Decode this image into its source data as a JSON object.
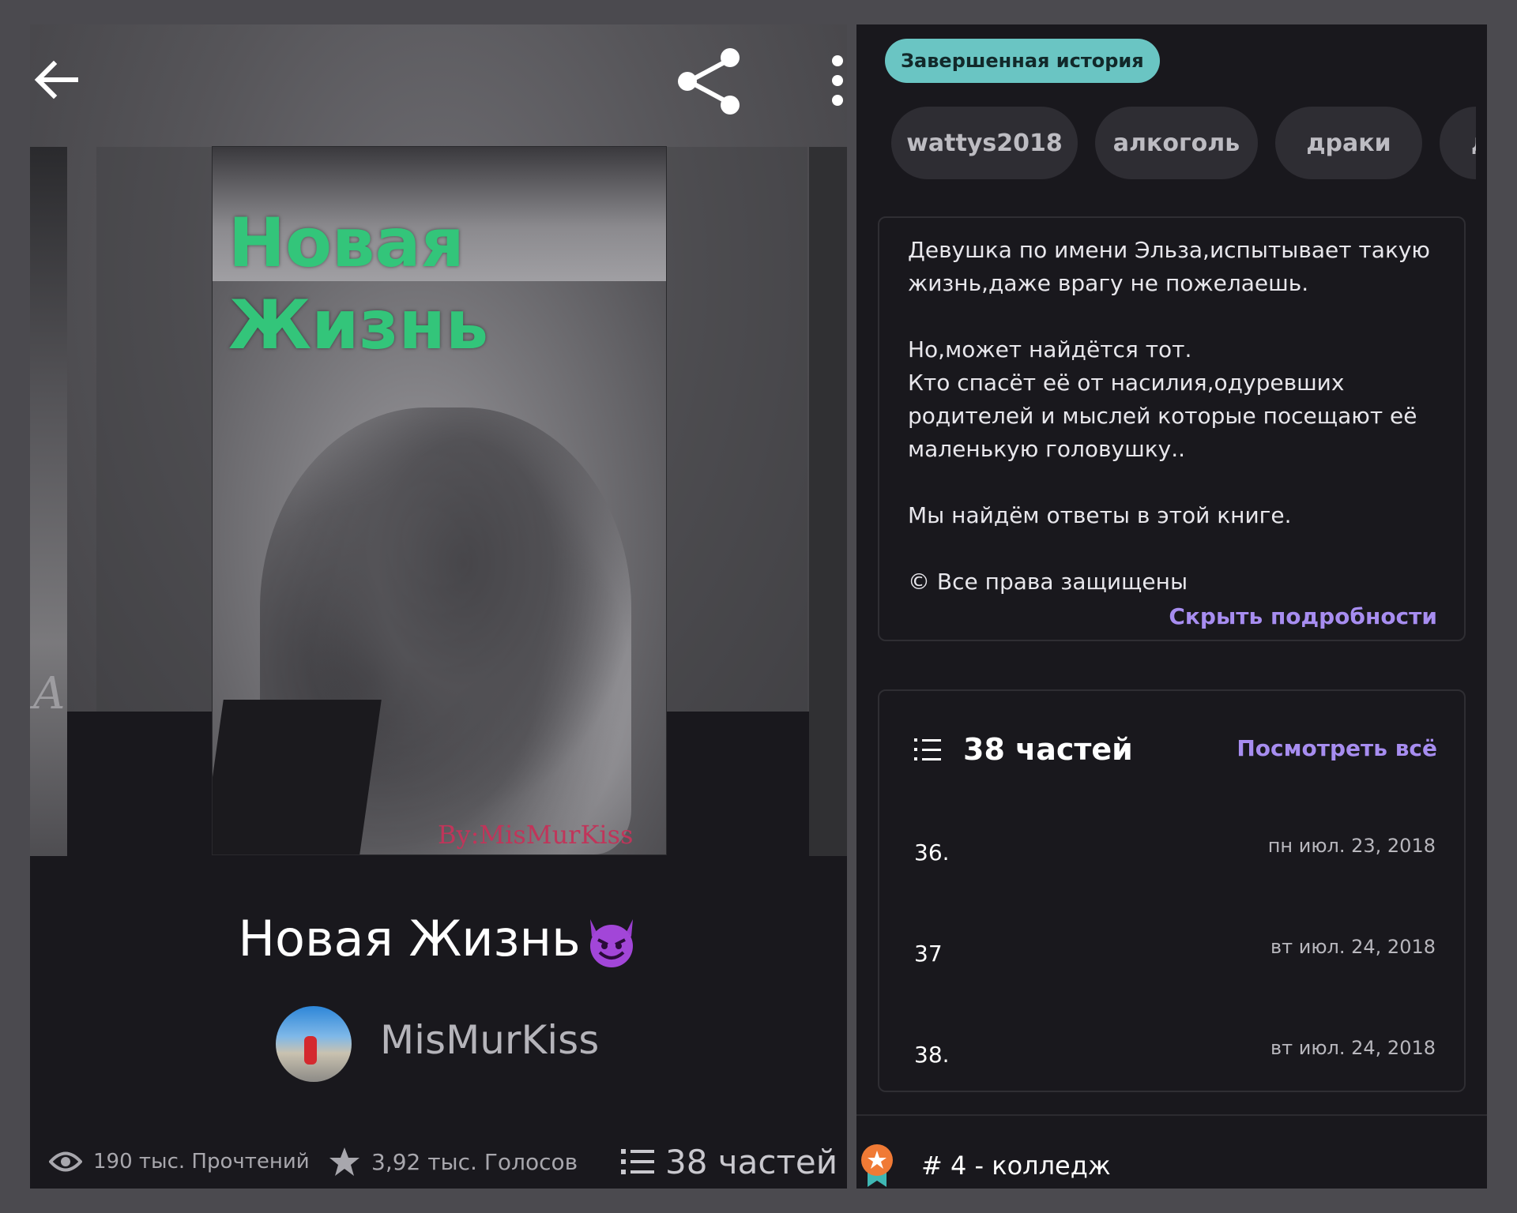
{
  "colors": {
    "panel_bg": "#19181d",
    "badge_bg": "#6ac5c3",
    "link_accent": "#a78df0",
    "cover_title": "#33c57a",
    "tag_bg": "#2e2d33",
    "rank_badge": "#f07a35"
  },
  "left": {
    "topbar": {
      "back_icon": "arrow-left-icon",
      "share_icon": "share-icon",
      "more_icon": "kebab-menu-icon"
    },
    "cover": {
      "title_line1": "Новая",
      "title_line2": "Жизнь",
      "byline": "By:MisMurKiss"
    },
    "title": "Новая Жизнь",
    "title_emoji": "smiling-devil-icon",
    "author": {
      "name": "MisMurKiss"
    },
    "stats": {
      "reads": "190 тыс. Прочтений",
      "votes": "3,92 тыс. Голосов",
      "parts": "38 частей"
    }
  },
  "right": {
    "badge": "Завершенная история",
    "tags": [
      "wattys2018",
      "алкоголь",
      "драки",
      "д"
    ],
    "description": {
      "paragraph1": "Девушка по имени Эльза,испытывает такую жизнь,даже врагу не пожелаешь.",
      "paragraph2_line1": "Но,может найдётся тот.",
      "paragraph2_line2": "Кто спасёт её от насилия,одуревших родителей и мыслей которые посещают её маленькую головушку..",
      "paragraph3": "Мы найдём ответы в этой книге.",
      "copyright": "© Все права защищены",
      "hide_link": "Скрыть подробности"
    },
    "parts": {
      "count_label": "38 частей",
      "view_all": "Посмотреть всё",
      "items": [
        {
          "number": "36.",
          "date": "пн июл. 23, 2018"
        },
        {
          "number": "37",
          "date": "вт июл. 24, 2018"
        },
        {
          "number": "38.",
          "date": "вт июл. 24, 2018"
        }
      ]
    },
    "ranking": {
      "text": "# 4 - колледж"
    }
  }
}
